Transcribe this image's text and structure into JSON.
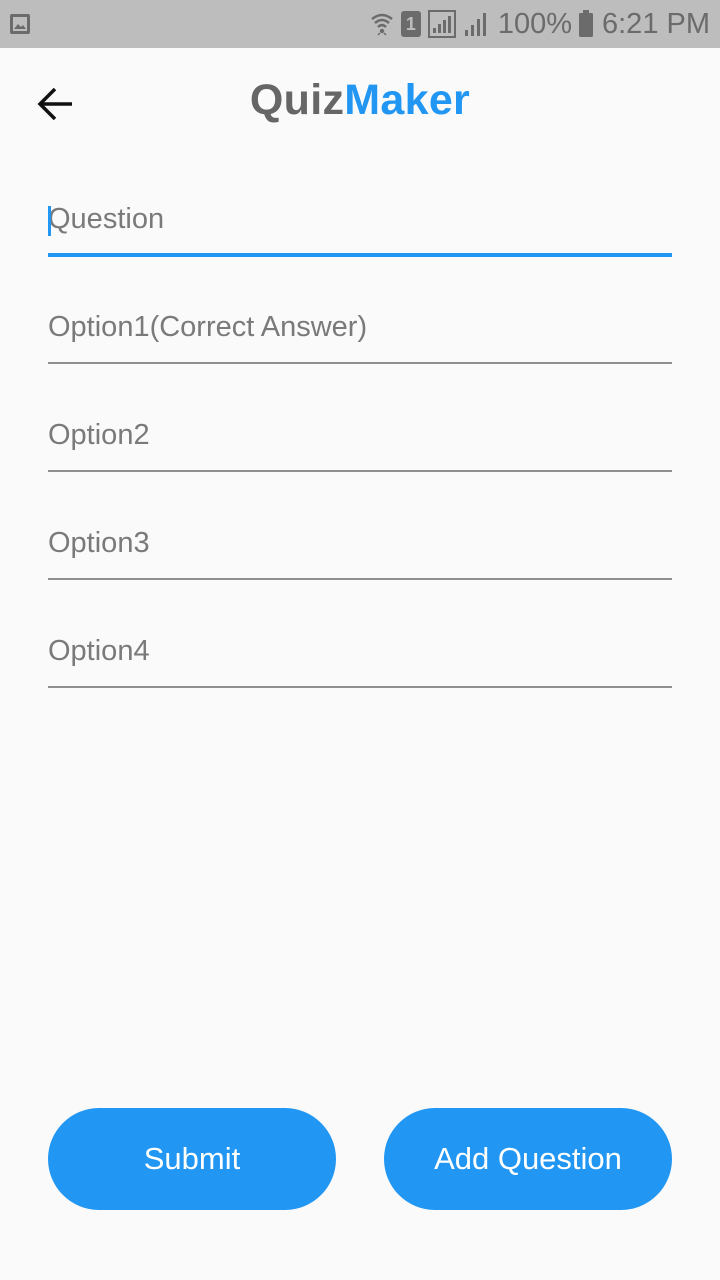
{
  "status_bar": {
    "battery_percent": "100%",
    "time": "6:21 PM",
    "sim_slot": "1",
    "icons": [
      "gallery-icon",
      "wifi-icon",
      "sim-icon",
      "signal-icon",
      "signal-icon",
      "battery-icon"
    ]
  },
  "app_bar": {
    "title_part1": "Quiz",
    "title_part2": "Maker",
    "back_icon": "arrow-left-icon"
  },
  "form": {
    "question": {
      "placeholder": "Question",
      "value": ""
    },
    "option1": {
      "placeholder": "Option1(Correct Answer)",
      "value": ""
    },
    "option2": {
      "placeholder": "Option2",
      "value": ""
    },
    "option3": {
      "placeholder": "Option3",
      "value": ""
    },
    "option4": {
      "placeholder": "Option4",
      "value": ""
    }
  },
  "actions": {
    "submit_label": "Submit",
    "add_question_label": "Add Question"
  },
  "colors": {
    "accent": "#2196f3",
    "title_gray": "#666666",
    "background": "#fafafa",
    "status_bar": "#bdbdbd"
  }
}
